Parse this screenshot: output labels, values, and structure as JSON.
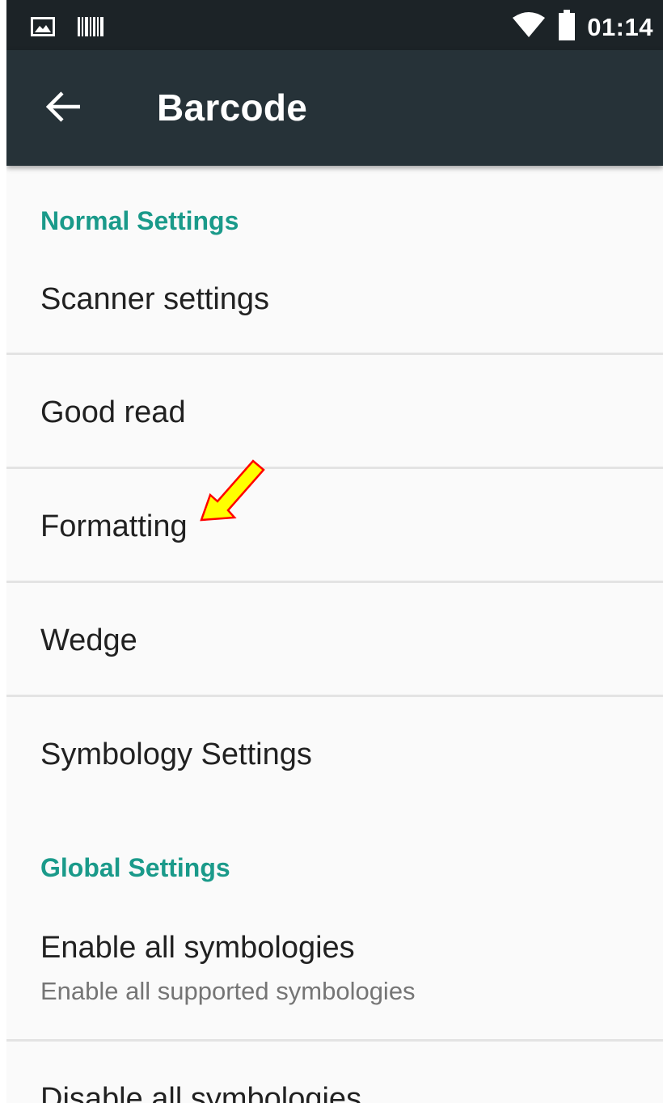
{
  "status_bar": {
    "time": "01:14",
    "left_icons": [
      "image-icon",
      "barcode-icon"
    ],
    "right_icons": [
      "wifi-icon",
      "battery-icon"
    ]
  },
  "app_bar": {
    "title": "Barcode",
    "back_icon": "arrow-back-icon",
    "background": "#263238"
  },
  "sections": [
    {
      "header": "Normal Settings",
      "items": [
        {
          "title": "Scanner settings"
        },
        {
          "title": "Good read"
        },
        {
          "title": "Formatting"
        },
        {
          "title": "Wedge"
        },
        {
          "title": "Symbology Settings"
        }
      ]
    },
    {
      "header": "Global Settings",
      "items": [
        {
          "title": "Enable all symbologies",
          "summary": "Enable all supported symbologies"
        },
        {
          "title": "Disable all symbologies"
        }
      ]
    }
  ],
  "colors": {
    "accent": "#1a9a8a",
    "annotation_arrow_fill": "#ffff00",
    "annotation_arrow_stroke": "#ff0000"
  }
}
